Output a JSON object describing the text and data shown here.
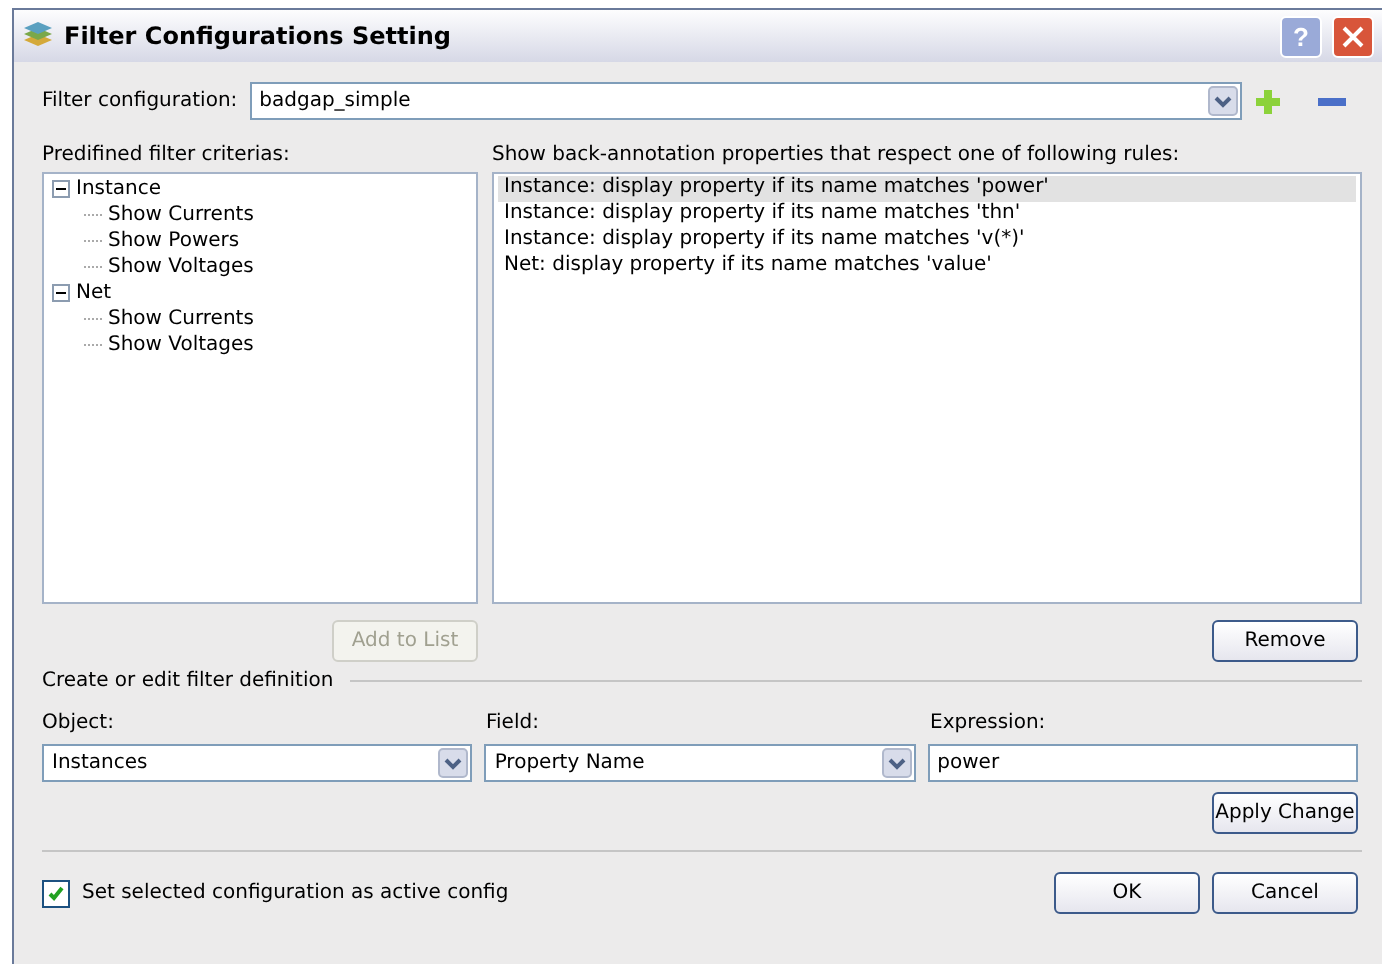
{
  "window": {
    "title": "Filter Configurations Setting",
    "help": "?"
  },
  "filter_configuration": {
    "label": "Filter configuration:",
    "value": "badgap_simple"
  },
  "predefined": {
    "label": "Predifined filter criterias:",
    "tree": [
      {
        "label": "Instance",
        "expanded": true,
        "children": [
          {
            "label": "Show Currents"
          },
          {
            "label": "Show Powers"
          },
          {
            "label": "Show Voltages"
          }
        ]
      },
      {
        "label": "Net",
        "expanded": true,
        "children": [
          {
            "label": "Show Currents"
          },
          {
            "label": "Show Voltages"
          }
        ]
      }
    ]
  },
  "rules": {
    "label": "Show back-annotation properties that respect one of following rules:",
    "items": [
      {
        "text": "Instance: display property if its name matches 'power'",
        "selected": true
      },
      {
        "text": "Instance: display property if its name matches 'thn'",
        "selected": false
      },
      {
        "text": "Instance: display property if its name matches 'v(*)'",
        "selected": false
      },
      {
        "text": "Net: display property if its name matches 'value'",
        "selected": false
      }
    ]
  },
  "add_button": {
    "label": "Add to List",
    "disabled": true
  },
  "remove_button": {
    "label": "Remove",
    "disabled": false
  },
  "definition": {
    "title": "Create or edit filter definition",
    "object": {
      "label": "Object:",
      "value": "Instances"
    },
    "field": {
      "label": "Field:",
      "value": "Property Name"
    },
    "expression": {
      "label": "Expression:",
      "value": "power"
    }
  },
  "apply_button": "Apply Change",
  "active_config": {
    "label": "Set selected configuration as active config",
    "checked": true
  },
  "buttons": [
    "OK",
    "Cancel"
  ]
}
